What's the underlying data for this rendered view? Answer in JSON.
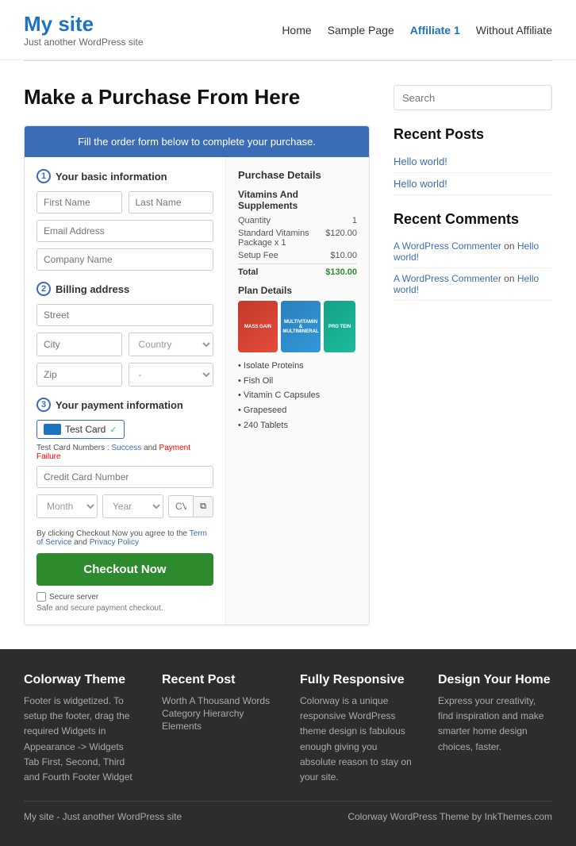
{
  "site": {
    "title": "My site",
    "description": "Just another WordPress site"
  },
  "nav": {
    "items": [
      {
        "label": "Home",
        "active": false
      },
      {
        "label": "Sample Page",
        "active": false
      },
      {
        "label": "Affiliate 1",
        "active": true
      },
      {
        "label": "Without Affiliate",
        "active": false
      }
    ]
  },
  "page": {
    "title": "Make a Purchase From Here"
  },
  "orderForm": {
    "header": "Fill the order form below to complete your purchase.",
    "section1": {
      "number": "1",
      "title": "Your basic information",
      "fields": {
        "firstName": "First Name",
        "lastName": "Last Name",
        "email": "Email Address",
        "company": "Company Name"
      }
    },
    "section2": {
      "number": "2",
      "title": "Billing address",
      "fields": {
        "street": "Street",
        "city": "City",
        "country": "Country",
        "zip": "Zip",
        "dash": "-"
      }
    },
    "section3": {
      "number": "3",
      "title": "Your payment information",
      "cardLabel": "Test Card",
      "testCardNumbers": "Test Card Numbers :",
      "success": "Success",
      "paymentFailure": "Payment Failure",
      "creditCard": "Credit Card Number",
      "month": "Month",
      "year": "Year",
      "cvv": "CVV"
    },
    "terms": "By clicking Checkout Now you agree to the",
    "termOfService": "Term of Service",
    "and": "and",
    "privacyPolicy": "Privacy Policy",
    "checkoutBtn": "Checkout Now",
    "secureServer": "Secure server",
    "safeText": "Safe and secure payment checkout."
  },
  "purchaseDetails": {
    "title": "Purchase Details",
    "productName": "Vitamins And Supplements",
    "quantity": {
      "label": "Quantity",
      "value": "1"
    },
    "standardPackage": "Standard Vitamins Package x 1",
    "standardPrice": "$120.00",
    "setupFee": "Setup Fee",
    "setupPrice": "$10.00",
    "total": "Total",
    "totalPrice": "$130.00",
    "planDetails": "Plan Details",
    "features": [
      "• Isolate Proteins",
      "• Fish Oil",
      "• Vitamin C Capsules",
      "• Grapeseed",
      "• 240 Tablets"
    ],
    "bottle1": "PROTEIN POWER",
    "bottle2": "MULTIVITAMIN & MULTIMINERAL",
    "bottle3": "MASS GAIN"
  },
  "sidebar": {
    "search": {
      "placeholder": "Search"
    },
    "recentPosts": {
      "title": "Recent Posts",
      "items": [
        {
          "label": "Hello world!"
        },
        {
          "label": "Hello world!"
        }
      ]
    },
    "recentComments": {
      "title": "Recent Comments",
      "items": [
        {
          "author": "A WordPress Commenter",
          "on": "on",
          "post": "Hello world!"
        },
        {
          "author": "A WordPress Commenter",
          "on": "on",
          "post": "Hello world!"
        }
      ]
    }
  },
  "footer": {
    "widgets": [
      {
        "title": "Colorway Theme",
        "text": "Footer is widgetized. To setup the footer, drag the required Widgets in Appearance -> Widgets Tab First, Second, Third and Fourth Footer Widget"
      },
      {
        "title": "Recent Post",
        "links": [
          "Worth A Thousand Words",
          "Category Hierarchy Elements"
        ]
      },
      {
        "title": "Fully Responsive",
        "text": "Colorway is a unique responsive WordPress theme design is fabulous enough giving you absolute reason to stay on your site."
      },
      {
        "title": "Design Your Home",
        "text": "Express your creativity, find inspiration and make smarter home design choices, faster."
      }
    ],
    "bottomLeft": "My site - Just another WordPress site",
    "bottomRight": "Colorway WordPress Theme by InkThemes.com"
  }
}
